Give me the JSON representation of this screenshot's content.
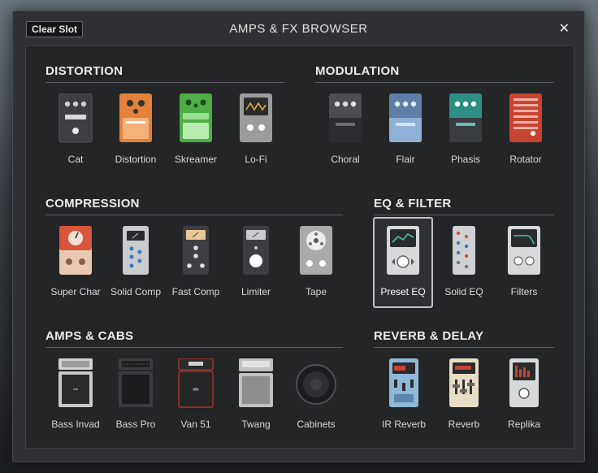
{
  "titlebar": {
    "clear_label": "Clear Slot",
    "title": "AMPS & FX BROWSER",
    "close_label": "✕"
  },
  "sections": {
    "distortion": {
      "title": "DISTORTION",
      "items": [
        "Cat",
        "Distortion",
        "Skreamer",
        "Lo-Fi"
      ]
    },
    "modulation": {
      "title": "MODULATION",
      "items": [
        "Choral",
        "Flair",
        "Phasis",
        "Rotator"
      ]
    },
    "compression": {
      "title": "COMPRESSION",
      "items": [
        "Super Char",
        "Solid Comp",
        "Fast Comp",
        "Limiter",
        "Tape"
      ]
    },
    "eqfilter": {
      "title": "EQ & FILTER",
      "items": [
        "Preset EQ",
        "Solid EQ",
        "Filters"
      ],
      "selected": "Preset EQ"
    },
    "ampscabs": {
      "title": "AMPS & CABS",
      "items": [
        "Bass Invad",
        "Bass Pro",
        "Van 51",
        "Twang",
        "Cabinets"
      ]
    },
    "reverbdelay": {
      "title": "REVERB & DELAY",
      "items": [
        "IR Reverb",
        "Reverb",
        "Replika"
      ]
    }
  },
  "colors": {
    "panel": "#232527",
    "window": "#2f3134",
    "accent_orange": "#e4813b",
    "accent_green": "#4daf45",
    "accent_red": "#c84432"
  }
}
